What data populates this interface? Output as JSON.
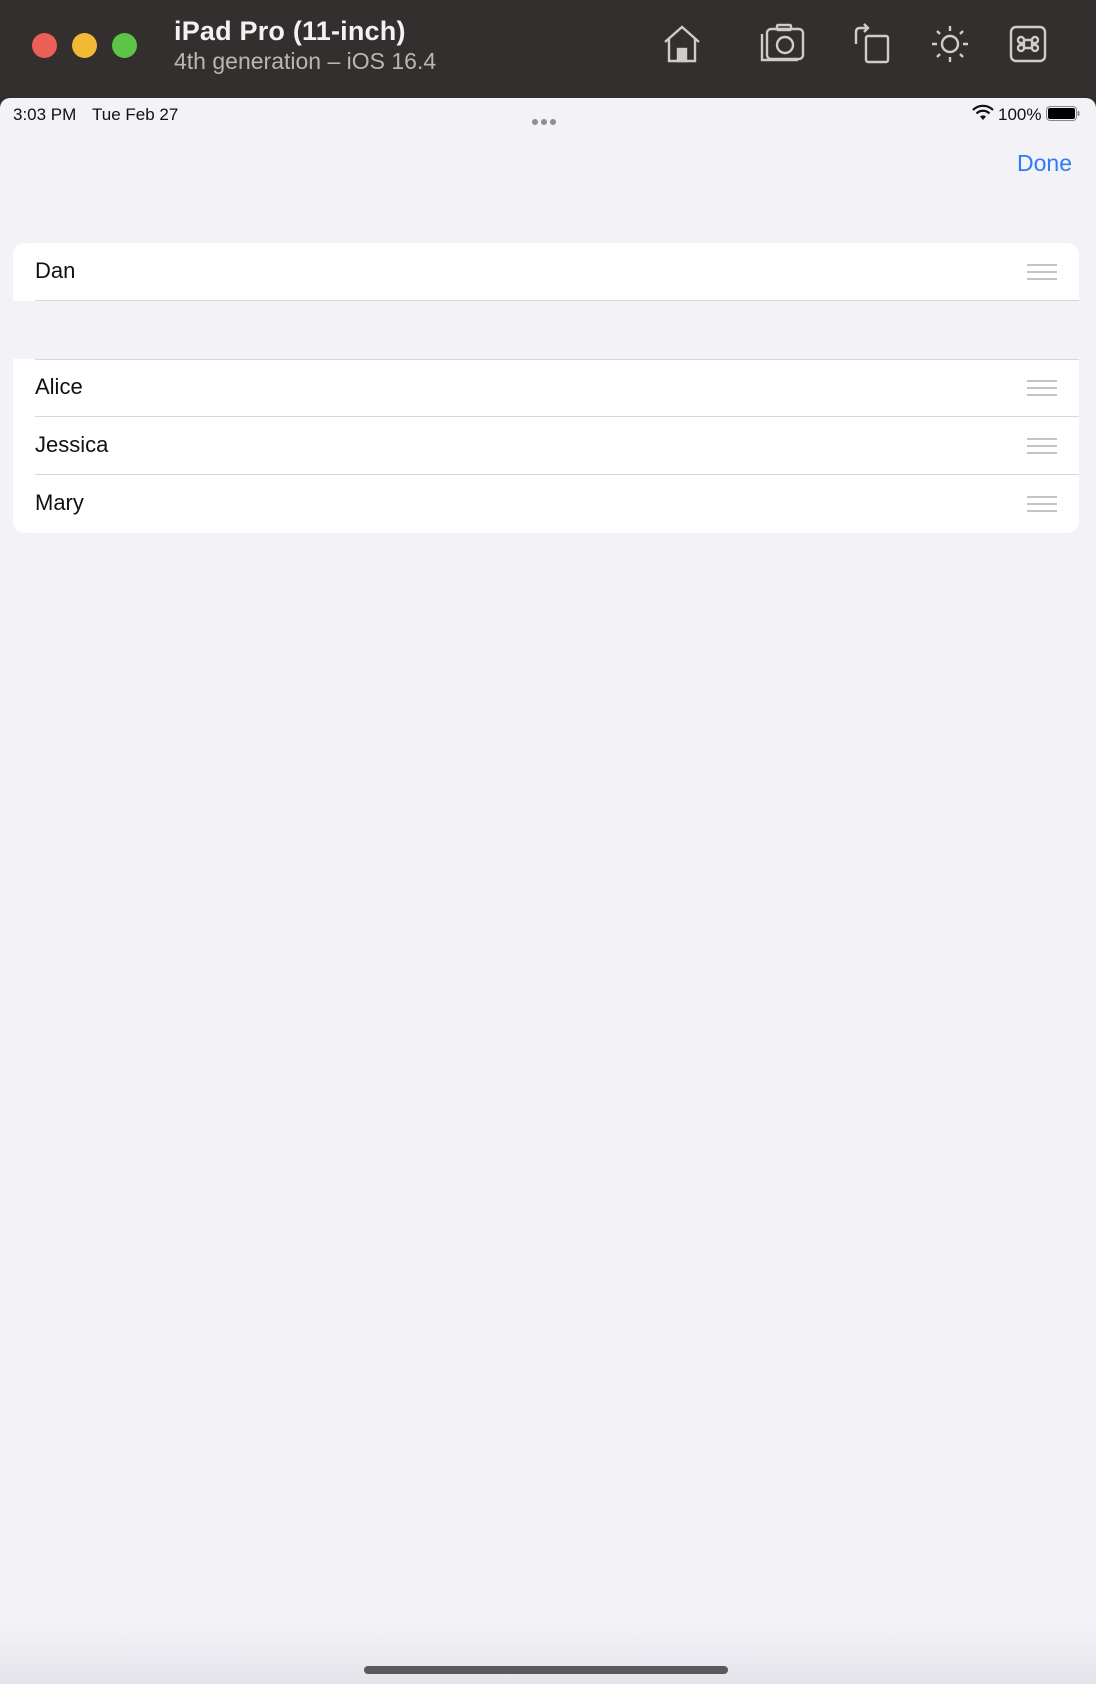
{
  "window": {
    "device_name": "iPad Pro (11-inch)",
    "device_subtitle": "4th generation – iOS 16.4",
    "toolbar_icons": [
      "home-icon",
      "screenshot-icon",
      "rotate-icon",
      "brightness-icon",
      "command-icon"
    ]
  },
  "status_bar": {
    "time": "3:03 PM",
    "date": "Tue Feb 27",
    "battery": "100%"
  },
  "nav": {
    "done_label": "Done"
  },
  "sections": [
    {
      "rows": [
        {
          "name": "Dan"
        }
      ]
    },
    {
      "rows": [
        {
          "name": "Alice"
        },
        {
          "name": "Jessica"
        },
        {
          "name": "Mary"
        }
      ]
    }
  ],
  "colors": {
    "accent": "#2f7cf6",
    "background": "#f2f2f7",
    "titlebar": "#332f2f"
  }
}
